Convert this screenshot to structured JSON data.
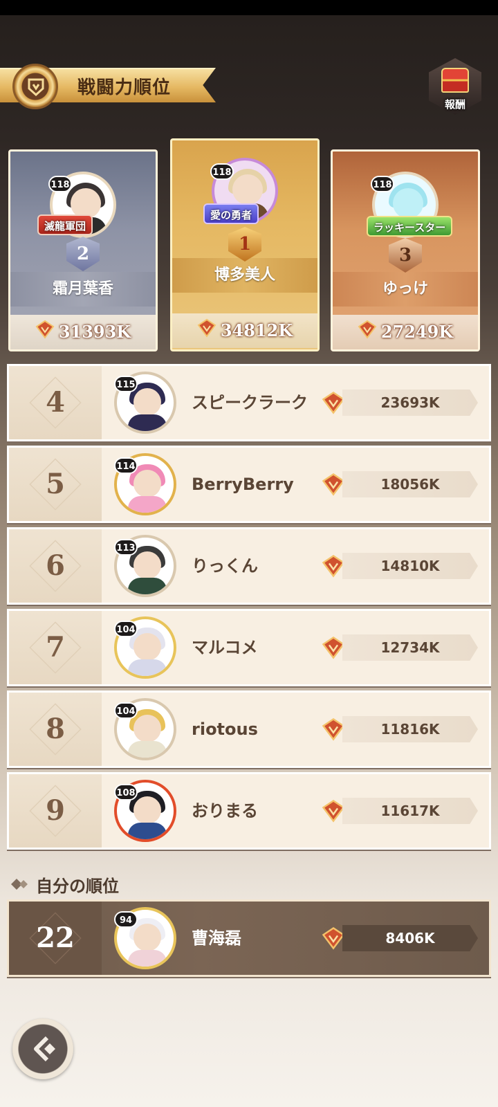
{
  "header": {
    "title": "戦闘力順位",
    "reward_label": "報酬"
  },
  "podium": [
    {
      "place": "2",
      "level": "118",
      "name": "霜月葉香",
      "title_badge": "滅龍軍団",
      "power": "31393K"
    },
    {
      "place": "1",
      "level": "118",
      "name": "博多美人",
      "title_badge": "愛の勇者",
      "power": "34812K"
    },
    {
      "place": "3",
      "level": "118",
      "name": "ゆっけ",
      "title_badge": "ラッキースター",
      "power": "27249K"
    }
  ],
  "rows": [
    {
      "rank": "4",
      "level": "115",
      "name": "スピークラーク",
      "power": "23693K"
    },
    {
      "rank": "5",
      "level": "114",
      "name": "BerryBerry",
      "power": "18056K"
    },
    {
      "rank": "6",
      "level": "113",
      "name": "りっくん",
      "power": "14810K"
    },
    {
      "rank": "7",
      "level": "104",
      "name": "マルコメ",
      "power": "12734K"
    },
    {
      "rank": "8",
      "level": "104",
      "name": "riotous",
      "power": "11816K"
    },
    {
      "rank": "9",
      "level": "108",
      "name": "おりまる",
      "power": "11617K"
    }
  ],
  "my_rank": {
    "label": "自分の順位",
    "rank": "22",
    "level": "94",
    "name": "曹海磊",
    "power": "8406K"
  },
  "colors": {
    "gold": "#e5b862",
    "silver": "#8e93a6",
    "bronze": "#d8955f",
    "accent_red": "#c8372a"
  },
  "icons": {
    "title_emblem": "shield-icon",
    "reward": "treasure-chest-icon",
    "power": "power-crest-icon",
    "back": "back-arrow-icon"
  }
}
